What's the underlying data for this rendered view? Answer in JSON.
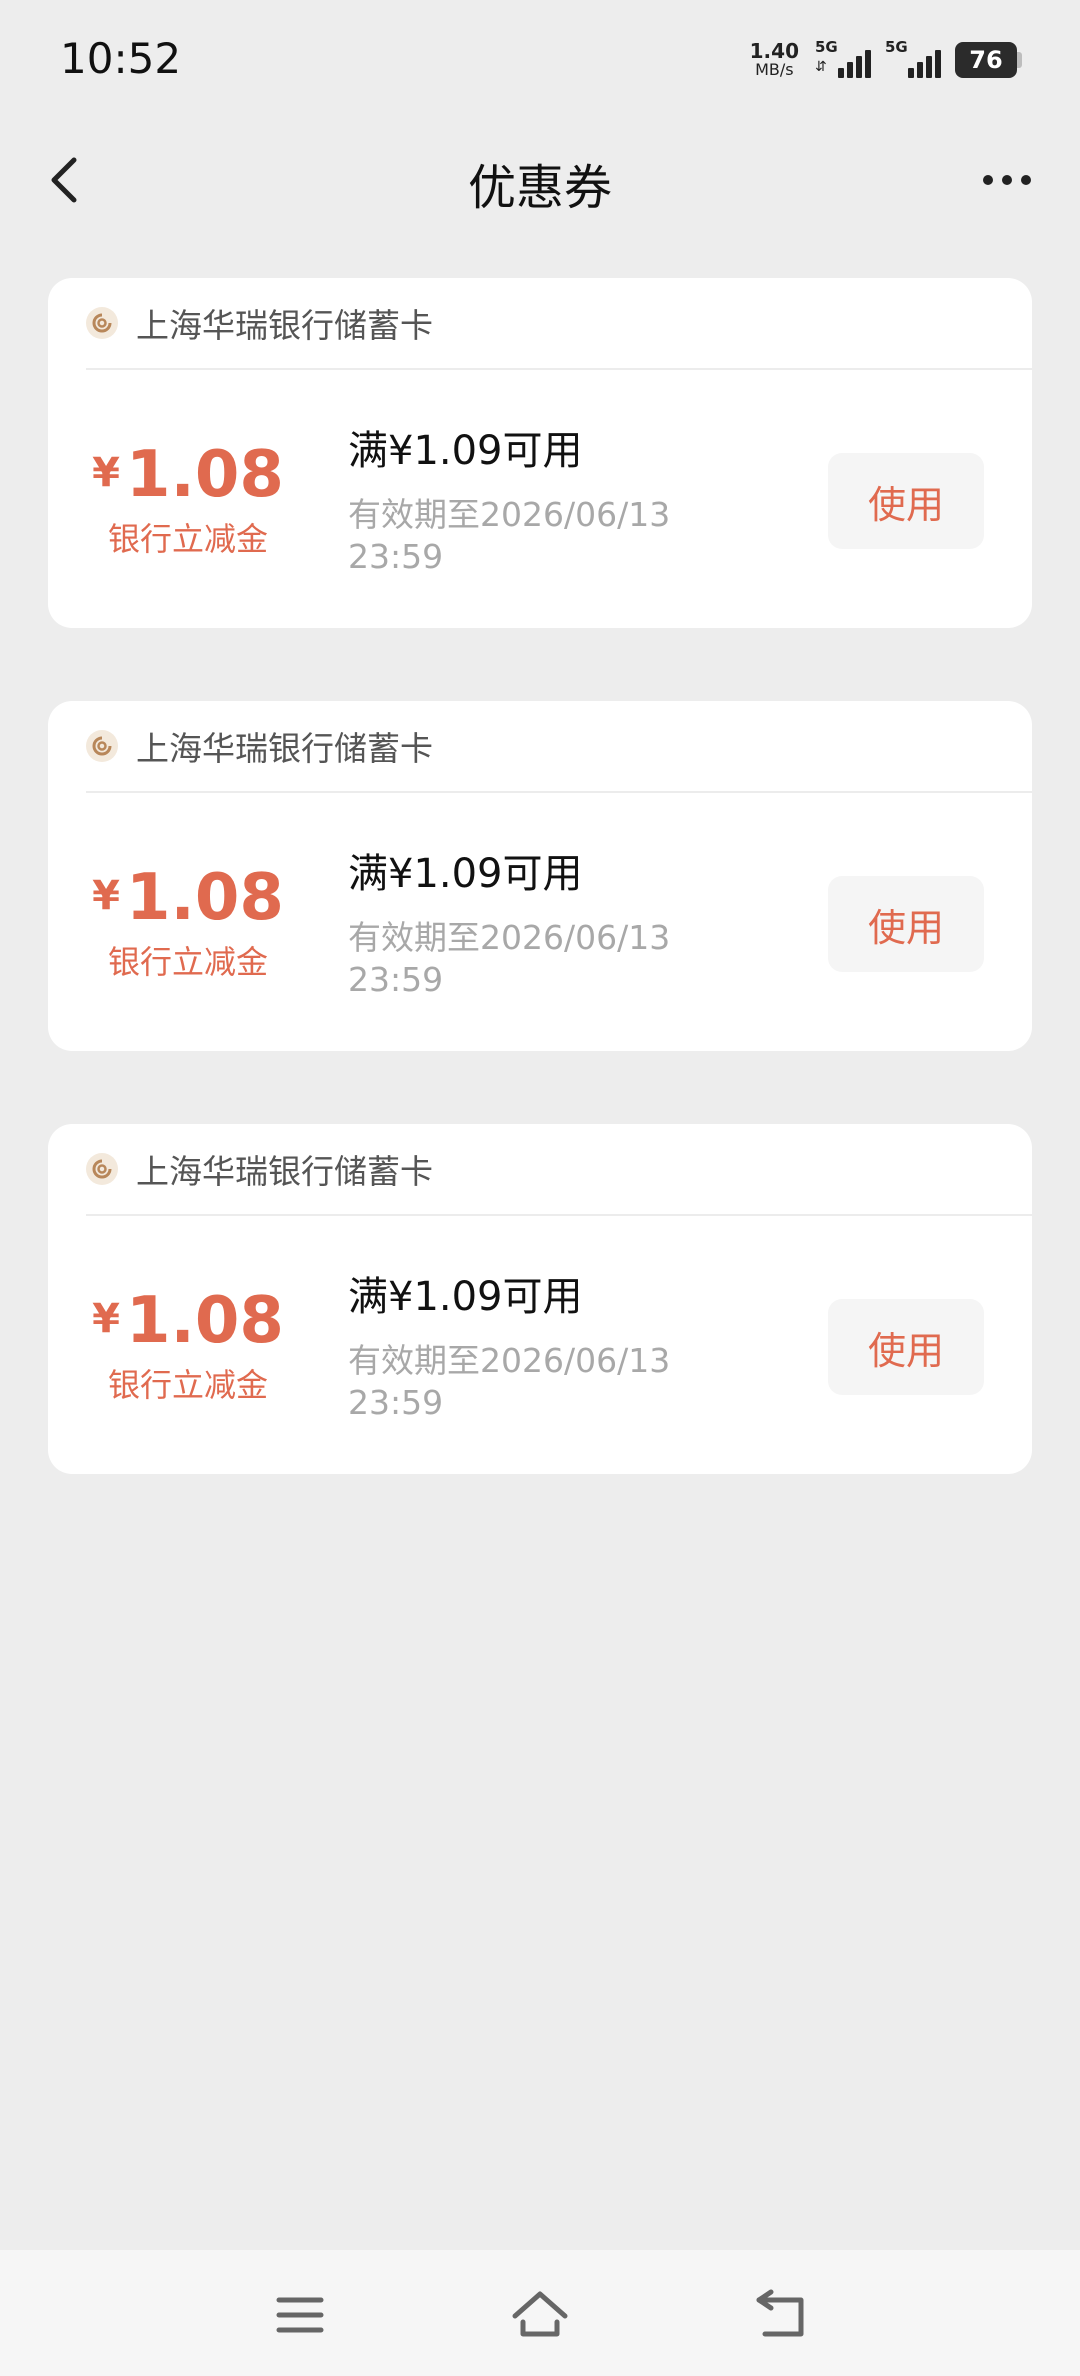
{
  "status": {
    "time": "10:52",
    "net_speed_value": "1.40",
    "net_speed_unit": "MB/s",
    "sim1_label": "5G",
    "sim2_label": "5G",
    "battery": "76"
  },
  "header": {
    "title": "优惠券",
    "back_icon": "chevron-left-icon",
    "more_icon": "more-horizontal-icon"
  },
  "colors": {
    "accent": "#e06a4f",
    "background": "#ededed"
  },
  "coupons": [
    {
      "bank": "上海华瑞银行储蓄卡",
      "currency": "¥",
      "amount": "1.08",
      "amount_label": "银行立减金",
      "threshold": "满¥1.09可用",
      "validity": "有效期至2026/06/13 23:59",
      "button": "使用"
    },
    {
      "bank": "上海华瑞银行储蓄卡",
      "currency": "¥",
      "amount": "1.08",
      "amount_label": "银行立减金",
      "threshold": "满¥1.09可用",
      "validity": "有效期至2026/06/13 23:59",
      "button": "使用"
    },
    {
      "bank": "上海华瑞银行储蓄卡",
      "currency": "¥",
      "amount": "1.08",
      "amount_label": "银行立减金",
      "threshold": "满¥1.09可用",
      "validity": "有效期至2026/06/13 23:59",
      "button": "使用"
    }
  ],
  "system_nav": {
    "menu_icon": "menu-icon",
    "home_icon": "home-icon",
    "back_icon": "back-icon"
  }
}
